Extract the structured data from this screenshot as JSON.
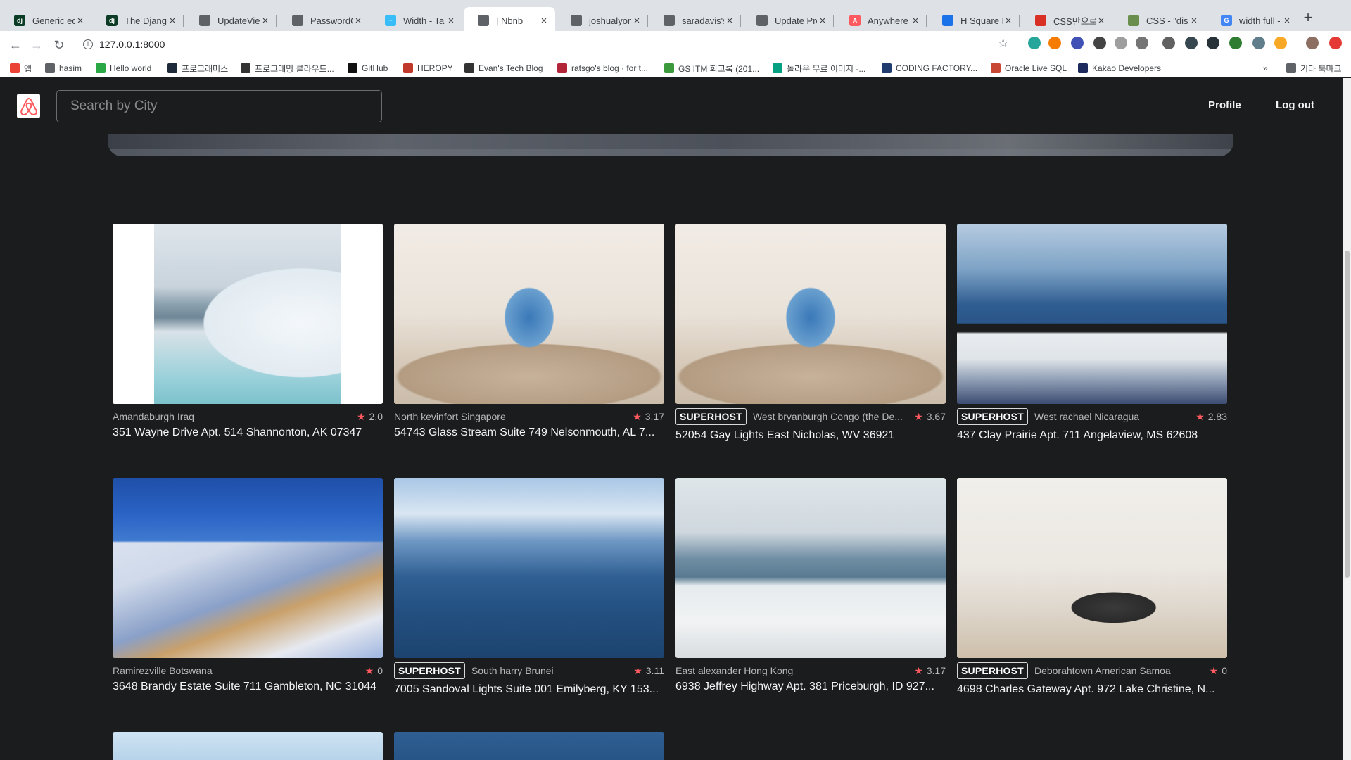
{
  "browser": {
    "tabs": [
      {
        "title": "Generic editi",
        "icon": "django-icon",
        "color": "#0c3c26",
        "glyph": "dj"
      },
      {
        "title": "The Django",
        "icon": "django-icon",
        "color": "#0c3c26",
        "glyph": "dj"
      },
      {
        "title": "UpdateView",
        "icon": "globe-icon",
        "color": "#5f6368",
        "glyph": ""
      },
      {
        "title": "PasswordCh",
        "icon": "globe-icon",
        "color": "#5f6368",
        "glyph": ""
      },
      {
        "title": "Width - Tailw",
        "icon": "tailwind-icon",
        "color": "#38bdf8",
        "glyph": "~"
      },
      {
        "title": "| Nbnb",
        "icon": "globe-icon",
        "color": "#5f6368",
        "glyph": ""
      },
      {
        "title": "joshualyons",
        "icon": "globe-icon",
        "color": "#5f6368",
        "glyph": ""
      },
      {
        "title": "saradavis's l",
        "icon": "globe-icon",
        "color": "#5f6368",
        "glyph": ""
      },
      {
        "title": "Update Prof",
        "icon": "globe-icon",
        "color": "#5f6368",
        "glyph": ""
      },
      {
        "title": "Anywhere - ",
        "icon": "airbnb-icon",
        "color": "#ff5a5f",
        "glyph": "A"
      },
      {
        "title": "H Square Ico",
        "icon": "flag-icon",
        "color": "#1a73e8",
        "glyph": ""
      },
      {
        "title": "CSS만으로 ",
        "icon": "bookmark-icon",
        "color": "#d93025",
        "glyph": ""
      },
      {
        "title": "CSS - \"displ",
        "icon": "mdn-icon",
        "color": "#6a8e4e",
        "glyph": ""
      },
      {
        "title": "width full - ",
        "icon": "google-icon",
        "color": "#4285f4",
        "glyph": "G"
      }
    ],
    "active_tab": 5,
    "url": "127.0.0.1:8000",
    "bookmarks": [
      {
        "label": "앱",
        "color": "#ea4335"
      },
      {
        "label": "hasim",
        "color": "#5f6368"
      },
      {
        "label": "Hello world",
        "color": "#2aa845"
      },
      {
        "label": "프로그래머스",
        "color": "#1e2a3a"
      },
      {
        "label": "프로그래밍 클라우드...",
        "color": "#333333"
      },
      {
        "label": "GitHub",
        "color": "#111111"
      },
      {
        "label": "HEROPY",
        "color": "#c0392b"
      },
      {
        "label": "Evan's Tech Blog",
        "color": "#333333"
      },
      {
        "label": "ratsgo's blog · for t...",
        "color": "#b3263a"
      },
      {
        "label": "GS ITM 회고록 (201...",
        "color": "#3c9a3c"
      },
      {
        "label": "놀라운 무료 이미지 -...",
        "color": "#05a081"
      },
      {
        "label": "CODING FACTORY...",
        "color": "#203b6e"
      },
      {
        "label": "Oracle Live SQL",
        "color": "#c74634"
      },
      {
        "label": "Kakao Developers",
        "color": "#1c2a5e"
      },
      {
        "label": "»",
        "color": ""
      },
      {
        "label": "기타 북마크",
        "color": "#5f6368"
      }
    ]
  },
  "header": {
    "search_placeholder": "Search by City",
    "profile_label": "Profile",
    "logout_label": "Log out"
  },
  "colors": {
    "background": "#1b1c1e",
    "accent": "#ff5a5f"
  },
  "rooms": [
    {
      "superhost": false,
      "city": "Amandaburgh Iraq",
      "rating": "2.0",
      "address": "351 Wayne Drive Apt. 514 Shannonton, AK 07347",
      "photo": "bath"
    },
    {
      "superhost": false,
      "city": "North kevinfort Singapore",
      "rating": "3.17",
      "address": "54743 Glass Stream Suite 749 Nelsonmouth, AL 7...",
      "photo": "living"
    },
    {
      "superhost": true,
      "city": "West bryanburgh Congo (the De...",
      "rating": "3.67",
      "address": "52054 Gay Lights East Nicholas, WV 36921",
      "photo": "living"
    },
    {
      "superhost": true,
      "city": "West rachael Nicaragua",
      "rating": "2.83",
      "address": "437 Clay Prairie Apt. 711 Angelaview, MS 62608",
      "photo": "window"
    },
    {
      "superhost": false,
      "city": "Ramirezville Botswana",
      "rating": "0",
      "address": "3648 Brandy Estate Suite 711 Gambleton, NC 31044",
      "photo": "terrace"
    },
    {
      "superhost": true,
      "city": "South harry Brunei",
      "rating": "3.11",
      "address": "7005 Sandoval Lights Suite 001 Emilyberg, KY 153...",
      "photo": "sea"
    },
    {
      "superhost": false,
      "city": "East alexander Hong Kong",
      "rating": "3.17",
      "address": "6938 Jeffrey Highway Apt. 381 Priceburgh, ID 927...",
      "photo": "deck"
    },
    {
      "superhost": true,
      "city": "Deborahtown American Samoa",
      "rating": "0",
      "address": "4698 Charles Gateway Apt. 972 Lake Christine, N...",
      "photo": "kitchen"
    }
  ],
  "superhost_label": "SUPERHOST"
}
